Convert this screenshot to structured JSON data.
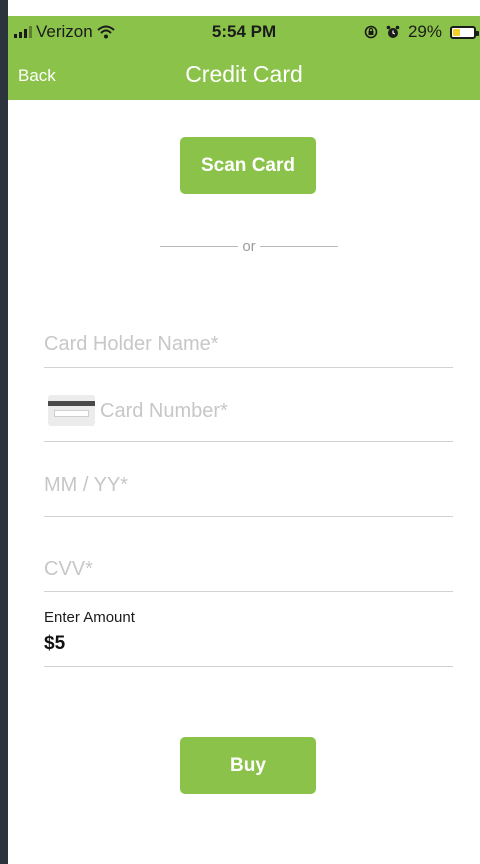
{
  "status_bar": {
    "carrier": "Verizon",
    "time": "5:54 PM",
    "battery": "29%",
    "battery_level_percent": 29,
    "icons": [
      "signal-bars-icon",
      "wifi-icon",
      "orientation-lock-icon",
      "alarm-icon",
      "battery-icon"
    ]
  },
  "nav": {
    "back_label": "Back",
    "title": "Credit Card"
  },
  "scan_button_label": "Scan Card",
  "divider_text": "or",
  "form": {
    "card_holder_placeholder": "Card Holder Name*",
    "card_number_placeholder": "Card Number*",
    "expiry_placeholder": "MM / YY*",
    "cvv_placeholder": "CVV*",
    "amount_label": "Enter Amount",
    "amount_value": "$5"
  },
  "buy_button_label": "Buy",
  "colors": {
    "accent": "#8bc34a",
    "background_frame": "#2b333d",
    "placeholder": "#c7c7c7",
    "battery_fill": "#f3d129"
  }
}
